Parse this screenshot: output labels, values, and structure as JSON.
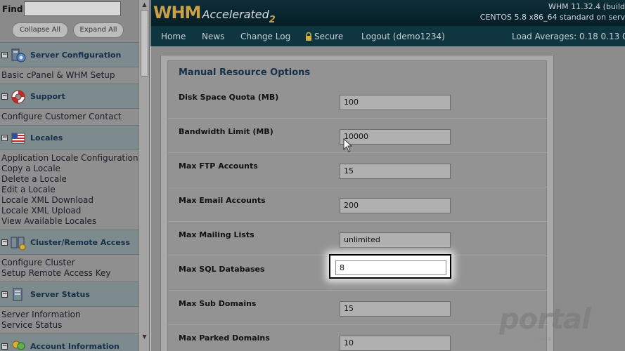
{
  "sidebar": {
    "find_label": "Find",
    "find_value": "",
    "collapse_all": "Collapse All",
    "expand_all": "Expand All",
    "sections": [
      {
        "title": "Server Configuration",
        "icon": "server-config-icon",
        "links": [
          "Basic cPanel & WHM Setup"
        ]
      },
      {
        "title": "Support",
        "icon": "lifebuoy-icon",
        "links": [
          "Configure Customer Contact"
        ]
      },
      {
        "title": "Locales",
        "icon": "flag-icon",
        "links": [
          "Application Locale Configuration",
          "Copy a Locale",
          "Delete a Locale",
          "Edit a Locale",
          "Locale XML Download",
          "Locale XML Upload",
          "View Available Locales"
        ]
      },
      {
        "title": "Cluster/Remote Access",
        "icon": "cluster-icon",
        "links": [
          "Configure Cluster",
          "Setup Remote Access Key"
        ]
      },
      {
        "title": "Server Status",
        "icon": "server-status-icon",
        "links": [
          "Server Information",
          "Service Status"
        ]
      },
      {
        "title": "Account Information",
        "icon": "account-info-icon",
        "links": []
      }
    ]
  },
  "header": {
    "logo_whm": "WHM",
    "logo_accelerated": "Accelerated",
    "logo_two": "2",
    "version": "WHM 11.32.4 (build",
    "os": "CENTOS 5.8 x86_64 standard on serv"
  },
  "nav": {
    "home": "Home",
    "news": "News",
    "changelog": "Change Log",
    "secure": "Secure",
    "logout": "Logout (demo1234)",
    "load": "Load Averages: 0.18 0.13 0"
  },
  "panel": {
    "title": "Manual Resource Options",
    "rows": [
      {
        "label": "Disk Space Quota (MB)",
        "value": "100"
      },
      {
        "label": "Bandwidth Limit (MB)",
        "value": "10000"
      },
      {
        "label": "Max FTP Accounts",
        "value": "15"
      },
      {
        "label": "Max Email Accounts",
        "value": "200"
      },
      {
        "label": "Max Mailing Lists",
        "value": "unlimited"
      },
      {
        "label": "Max SQL Databases",
        "value": "8"
      },
      {
        "label": "Max Sub Domains",
        "value": "15"
      },
      {
        "label": "Max Parked Domains",
        "value": "10"
      }
    ]
  },
  "watermark": {
    "text": "portal",
    "subtext": "web hosting"
  }
}
